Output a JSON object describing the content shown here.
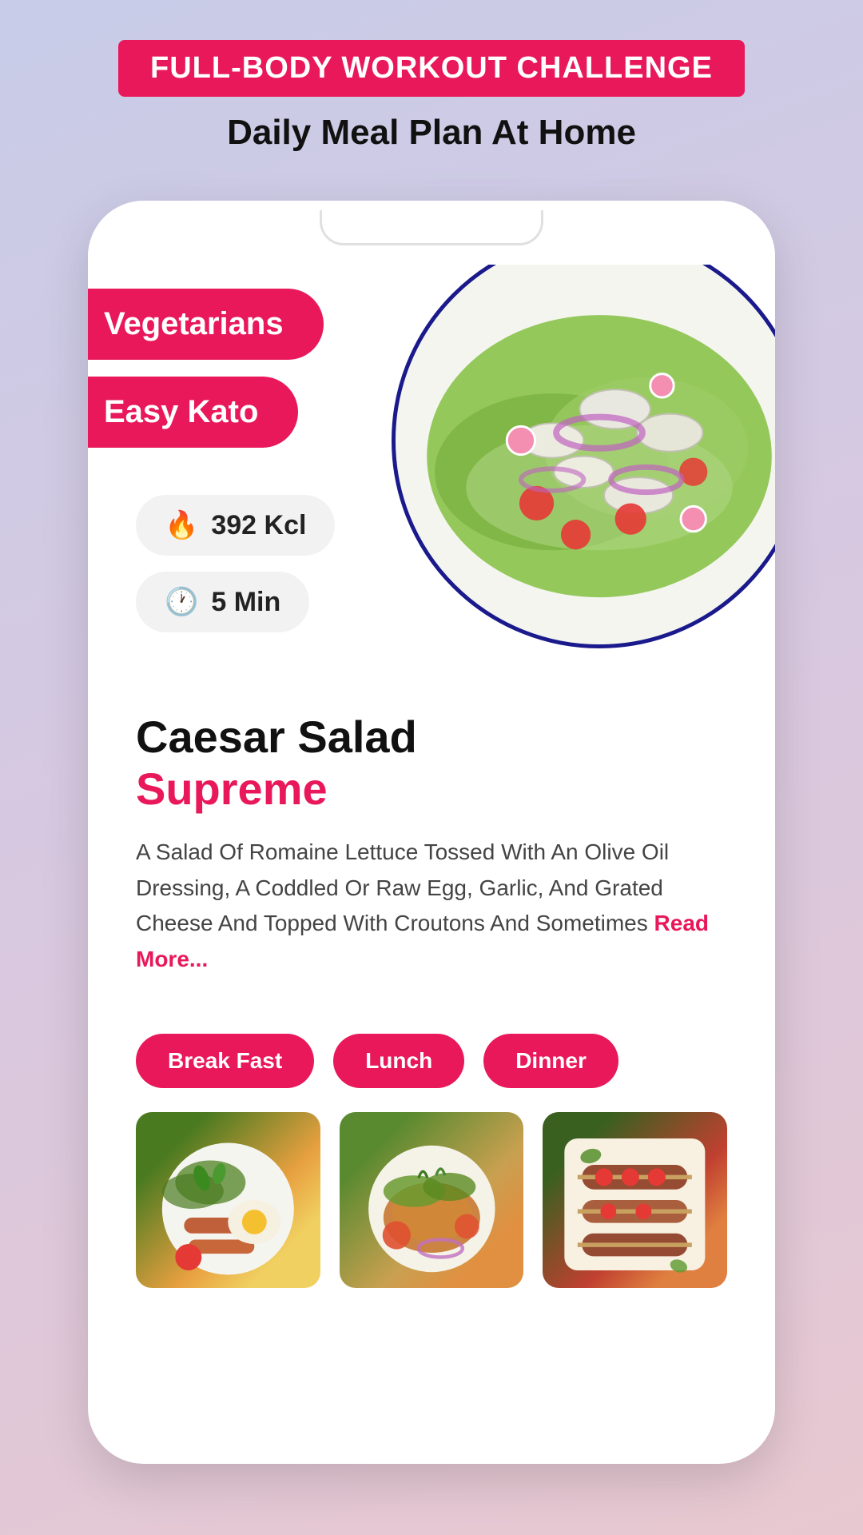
{
  "header": {
    "badge": "FULL-BODY WORKOUT CHALLENGE",
    "subtitle": "Daily Meal Plan At Home"
  },
  "tags": [
    {
      "id": "vegetarians",
      "label": "Vegetarians"
    },
    {
      "id": "easy-kato",
      "label": "Easy Kato"
    }
  ],
  "stats": [
    {
      "id": "calories",
      "icon": "🔥",
      "value": "392 Kcl"
    },
    {
      "id": "time",
      "icon": "🕐",
      "value": "5 Min"
    }
  ],
  "recipe": {
    "title_black": "Caesar Salad",
    "title_pink": "Supreme",
    "description": "A Salad Of Romaine Lettuce Tossed With An Olive Oil Dressing, A Coddled Or Raw Egg, Garlic, And Grated Cheese And Topped With Croutons And Sometimes",
    "read_more": "Read More..."
  },
  "meal_tabs": [
    {
      "id": "breakfast",
      "label": "Break Fast"
    },
    {
      "id": "lunch",
      "label": "Lunch"
    },
    {
      "id": "dinner",
      "label": "Dinner"
    }
  ]
}
